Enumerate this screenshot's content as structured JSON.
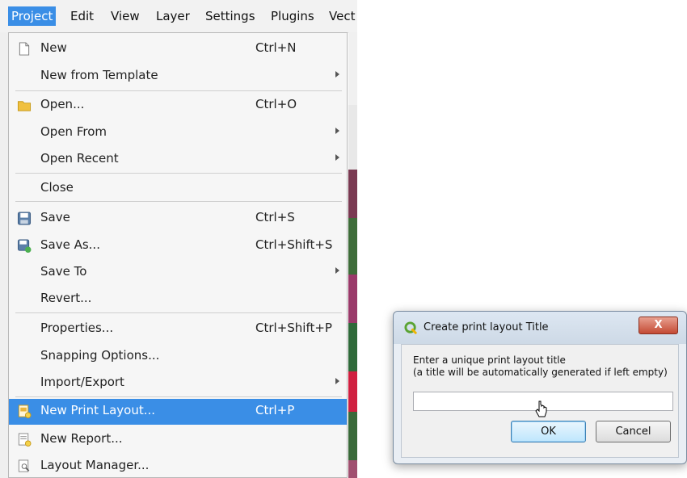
{
  "menubar": {
    "items": [
      {
        "label": "Project",
        "active": true
      },
      {
        "label": "Edit"
      },
      {
        "label": "View"
      },
      {
        "label": "Layer"
      },
      {
        "label": "Settings"
      },
      {
        "label": "Plugins"
      },
      {
        "label": "Vect"
      }
    ]
  },
  "menu": {
    "items": [
      {
        "label": "New",
        "shortcut": "Ctrl+N",
        "icon": "new-file-icon"
      },
      {
        "label": "New from Template",
        "submenu": true
      },
      {
        "label": "Open...",
        "shortcut": "Ctrl+O",
        "icon": "folder-icon"
      },
      {
        "label": "Open From",
        "submenu": true
      },
      {
        "label": "Open Recent",
        "submenu": true
      },
      {
        "label": "Close"
      },
      {
        "label": "Save",
        "shortcut": "Ctrl+S",
        "icon": "save-icon"
      },
      {
        "label": "Save As...",
        "shortcut": "Ctrl+Shift+S",
        "icon": "save-as-icon"
      },
      {
        "label": "Save To",
        "submenu": true
      },
      {
        "label": "Revert..."
      },
      {
        "label": "Properties...",
        "shortcut": "Ctrl+Shift+P"
      },
      {
        "label": "Snapping Options..."
      },
      {
        "label": "Import/Export",
        "submenu": true
      },
      {
        "label": "New Print Layout...",
        "shortcut": "Ctrl+P",
        "icon": "print-layout-icon",
        "highlighted": true
      },
      {
        "label": "New Report...",
        "icon": "report-icon"
      },
      {
        "label": "Layout Manager...",
        "icon": "layout-manager-icon"
      }
    ]
  },
  "dialog": {
    "title": "Create print layout Title",
    "close_label": "X",
    "prompt_line1": "Enter a unique print layout title",
    "prompt_line2": "(a title will be automatically generated if left empty)",
    "input_value": "",
    "ok_label": "OK",
    "cancel_label": "Cancel"
  },
  "colors": {
    "highlight": "#3a8ee6",
    "close_button": "#c44a34"
  }
}
